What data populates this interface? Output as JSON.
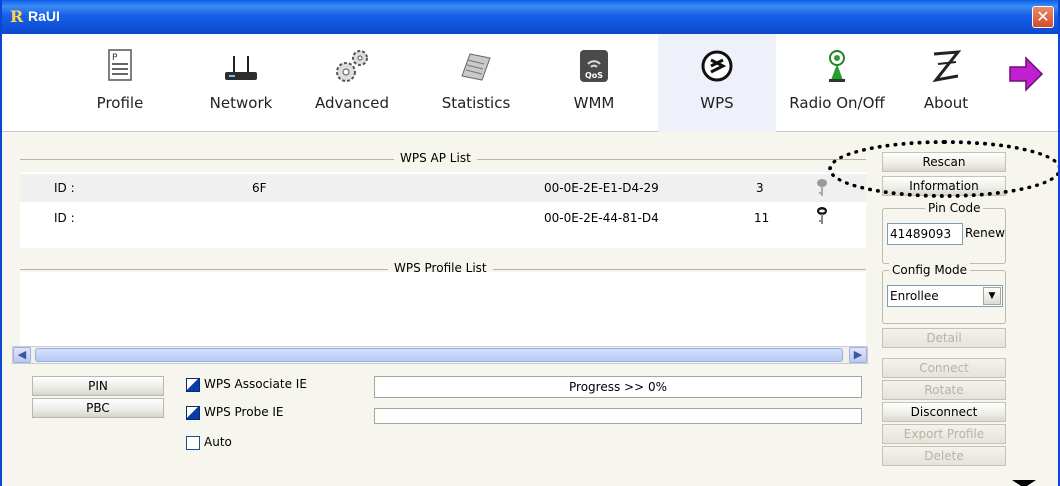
{
  "window": {
    "title": "RaUI",
    "logo": "R",
    "close_label": "✕"
  },
  "toolbar": {
    "items": [
      {
        "label": "Profile",
        "icon": "profile-icon"
      },
      {
        "label": "Network",
        "icon": "network-icon"
      },
      {
        "label": "Advanced",
        "icon": "advanced-icon"
      },
      {
        "label": "Statistics",
        "icon": "statistics-icon"
      },
      {
        "label": "WMM",
        "icon": "wmm-icon"
      },
      {
        "label": "WPS",
        "icon": "wps-icon"
      },
      {
        "label": "Radio On/Off",
        "icon": "radio-icon"
      },
      {
        "label": "About",
        "icon": "about-icon"
      }
    ],
    "active": "WPS",
    "more_icon": "arrow-right-icon"
  },
  "ap_list": {
    "title": "WPS AP List",
    "rows": [
      {
        "id_label": "ID :",
        "name": "6F",
        "mac": "00-0E-2E-E1-D4-29",
        "channel": "3",
        "icon": "key-icon"
      },
      {
        "id_label": "ID :",
        "name": "",
        "mac": "00-0E-2E-44-81-D4",
        "channel": "11",
        "icon": "key-icon"
      }
    ]
  },
  "profile_list": {
    "title": "WPS Profile List"
  },
  "controls": {
    "pin_button": "PIN",
    "pbc_button": "PBC",
    "assoc_ie_label": "WPS Associate IE",
    "probe_ie_label": "WPS Probe IE",
    "auto_label": "Auto",
    "progress_text": "Progress >> 0%",
    "progress_value": 0
  },
  "side": {
    "rescan": "Rescan",
    "information": "Information",
    "pin_code_title": "Pin Code",
    "pin_code_value": "41489093",
    "renew": "Renew",
    "config_mode_title": "Config Mode",
    "config_mode_value": "Enrollee",
    "detail": "Detail",
    "connect": "Connect",
    "rotate": "Rotate",
    "disconnect": "Disconnect",
    "export_profile": "Export Profile",
    "delete": "Delete"
  },
  "colors": {
    "titlebar": "#0a5fe8",
    "accent": "#0a3ca8",
    "disabled_text": "#b5b4a6"
  }
}
